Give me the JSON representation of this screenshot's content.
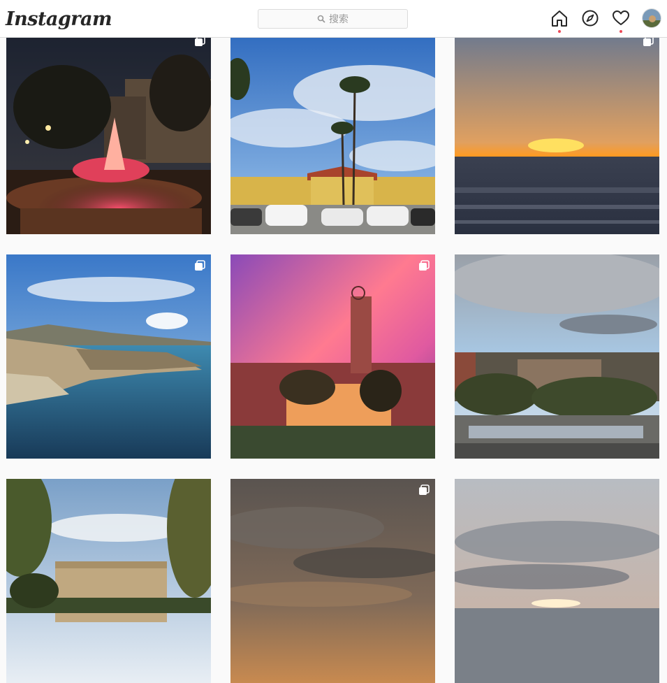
{
  "header": {
    "logo_text": "Instagram",
    "search_placeholder": "搜索",
    "icons": [
      "home-icon",
      "explore-icon",
      "activity-heart-icon",
      "profile-avatar"
    ],
    "notification_color": "#ed4956"
  },
  "grid": {
    "posts": [
      {
        "subject": "night-fountain",
        "multi": true
      },
      {
        "subject": "palm-trees-campus",
        "multi": false
      },
      {
        "subject": "ocean-sunset",
        "multi": true
      },
      {
        "subject": "coastal-cliffs",
        "multi": true
      },
      {
        "subject": "pink-sky-tower",
        "multi": true
      },
      {
        "subject": "campus-overlook",
        "multi": false
      },
      {
        "subject": "library-trees",
        "multi": false
      },
      {
        "subject": "dramatic-clouds",
        "multi": true
      },
      {
        "subject": "cloudy-sunset",
        "multi": false
      }
    ]
  }
}
